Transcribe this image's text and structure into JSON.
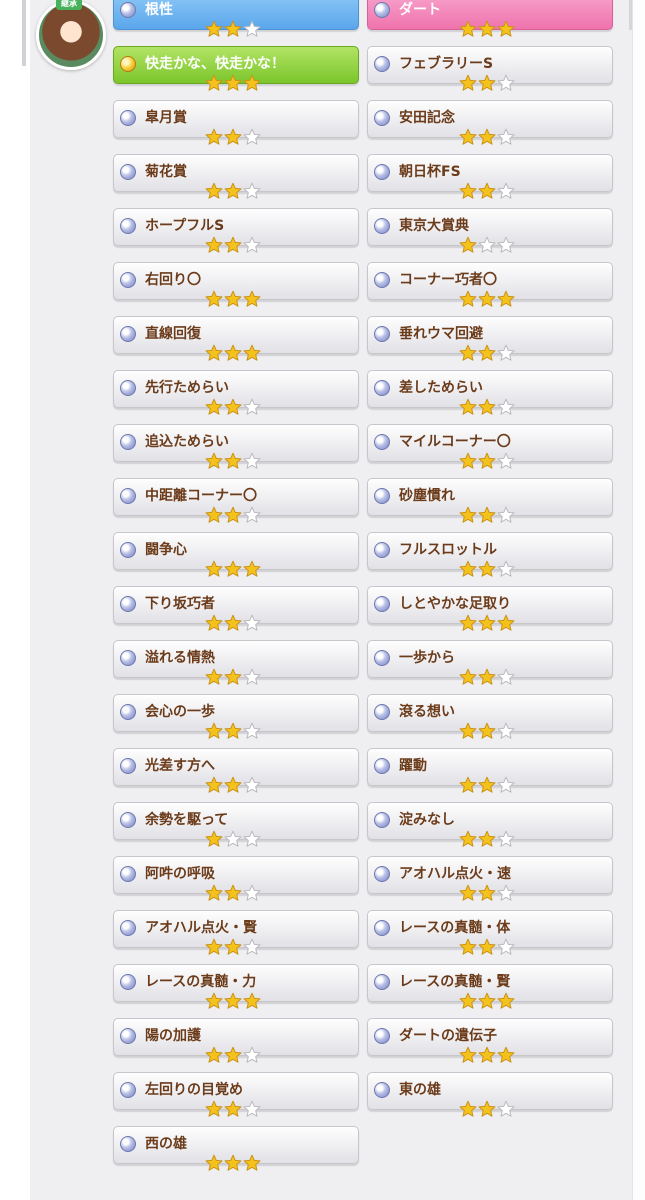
{
  "character": {
    "badge": "継承"
  },
  "colors": {
    "star_on": "#f5c21c",
    "star_off": "#ffffff",
    "text": "#6b3b1a"
  },
  "left_column": [
    {
      "name": "根性",
      "stars": 2,
      "style": "blue"
    },
    {
      "name": "快走かな、快走かな！",
      "stars": 3,
      "style": "green"
    },
    {
      "name": "皐月賞",
      "stars": 2
    },
    {
      "name": "菊花賞",
      "stars": 2
    },
    {
      "name": "ホープフルS",
      "stars": 2
    },
    {
      "name": "右回り〇",
      "stars": 3
    },
    {
      "name": "直線回復",
      "stars": 3
    },
    {
      "name": "先行ためらい",
      "stars": 2
    },
    {
      "name": "追込ためらい",
      "stars": 2
    },
    {
      "name": "中距離コーナー〇",
      "stars": 2
    },
    {
      "name": "闘争心",
      "stars": 3
    },
    {
      "name": "下り坂巧者",
      "stars": 2
    },
    {
      "name": "溢れる情熱",
      "stars": 2
    },
    {
      "name": "会心の一歩",
      "stars": 2
    },
    {
      "name": "光差す方へ",
      "stars": 2
    },
    {
      "name": "余勢を駆って",
      "stars": 1
    },
    {
      "name": "阿吽の呼吸",
      "stars": 2
    },
    {
      "name": "アオハル点火・賢",
      "stars": 2
    },
    {
      "name": "レースの真髄・力",
      "stars": 3
    },
    {
      "name": "陽の加護",
      "stars": 2
    },
    {
      "name": "左回りの目覚め",
      "stars": 2
    },
    {
      "name": "西の雄",
      "stars": 3
    }
  ],
  "right_column": [
    {
      "name": "ダート",
      "stars": 3,
      "style": "pink"
    },
    {
      "name": "フェブラリーS",
      "stars": 2
    },
    {
      "name": "安田記念",
      "stars": 2
    },
    {
      "name": "朝日杯FS",
      "stars": 2
    },
    {
      "name": "東京大賞典",
      "stars": 1
    },
    {
      "name": "コーナー巧者〇",
      "stars": 3
    },
    {
      "name": "垂れウマ回避",
      "stars": 2
    },
    {
      "name": "差しためらい",
      "stars": 2
    },
    {
      "name": "マイルコーナー〇",
      "stars": 2
    },
    {
      "name": "砂塵慣れ",
      "stars": 2
    },
    {
      "name": "フルスロットル",
      "stars": 2
    },
    {
      "name": "しとやかな足取り",
      "stars": 3
    },
    {
      "name": "一歩から",
      "stars": 2
    },
    {
      "name": "滾る想い",
      "stars": 2
    },
    {
      "name": "躍動",
      "stars": 2
    },
    {
      "name": "淀みなし",
      "stars": 2
    },
    {
      "name": "アオハル点火・速",
      "stars": 2
    },
    {
      "name": "レースの真髄・体",
      "stars": 2
    },
    {
      "name": "レースの真髄・賢",
      "stars": 3
    },
    {
      "name": "ダートの遺伝子",
      "stars": 3
    },
    {
      "name": "東の雄",
      "stars": 2
    }
  ]
}
